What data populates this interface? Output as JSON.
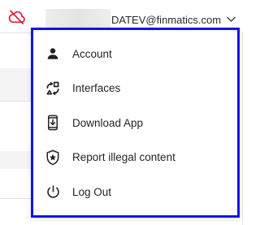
{
  "colors": {
    "accent_border": "#1313e6",
    "cloud_icon": "#e0203a",
    "text": "#242424"
  },
  "header": {
    "cloud_icon": "cloud-off-icon",
    "account_email": "DATEV@finmatics.com",
    "chevron_icon": "chevron-down-icon"
  },
  "menu": {
    "items": [
      {
        "label": "Account",
        "icon": "person-icon"
      },
      {
        "label": "Interfaces",
        "icon": "interfaces-icon"
      },
      {
        "label": "Download App",
        "icon": "phone-download-icon"
      },
      {
        "label": "Report illegal content",
        "icon": "shield-star-icon"
      },
      {
        "label": "Log Out",
        "icon": "power-icon"
      }
    ]
  }
}
